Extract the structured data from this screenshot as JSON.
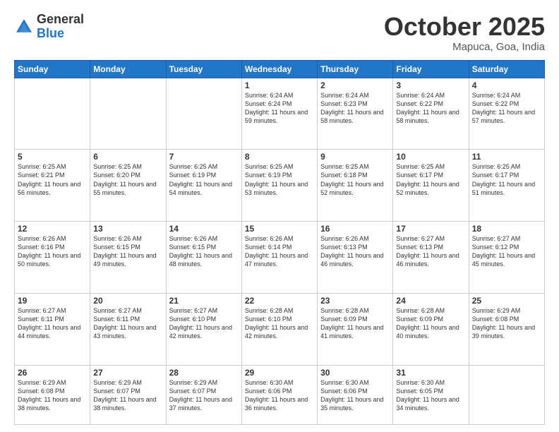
{
  "logo": {
    "general": "General",
    "blue": "Blue"
  },
  "header": {
    "month": "October 2025",
    "location": "Mapuca, Goa, India"
  },
  "weekdays": [
    "Sunday",
    "Monday",
    "Tuesday",
    "Wednesday",
    "Thursday",
    "Friday",
    "Saturday"
  ],
  "weeks": [
    [
      {
        "day": "",
        "info": ""
      },
      {
        "day": "",
        "info": ""
      },
      {
        "day": "",
        "info": ""
      },
      {
        "day": "1",
        "info": "Sunrise: 6:24 AM\nSunset: 6:24 PM\nDaylight: 11 hours\nand 59 minutes."
      },
      {
        "day": "2",
        "info": "Sunrise: 6:24 AM\nSunset: 6:23 PM\nDaylight: 11 hours\nand 58 minutes."
      },
      {
        "day": "3",
        "info": "Sunrise: 6:24 AM\nSunset: 6:22 PM\nDaylight: 11 hours\nand 58 minutes."
      },
      {
        "day": "4",
        "info": "Sunrise: 6:24 AM\nSunset: 6:22 PM\nDaylight: 11 hours\nand 57 minutes."
      }
    ],
    [
      {
        "day": "5",
        "info": "Sunrise: 6:25 AM\nSunset: 6:21 PM\nDaylight: 11 hours\nand 56 minutes."
      },
      {
        "day": "6",
        "info": "Sunrise: 6:25 AM\nSunset: 6:20 PM\nDaylight: 11 hours\nand 55 minutes."
      },
      {
        "day": "7",
        "info": "Sunrise: 6:25 AM\nSunset: 6:19 PM\nDaylight: 11 hours\nand 54 minutes."
      },
      {
        "day": "8",
        "info": "Sunrise: 6:25 AM\nSunset: 6:19 PM\nDaylight: 11 hours\nand 53 minutes."
      },
      {
        "day": "9",
        "info": "Sunrise: 6:25 AM\nSunset: 6:18 PM\nDaylight: 11 hours\nand 52 minutes."
      },
      {
        "day": "10",
        "info": "Sunrise: 6:25 AM\nSunset: 6:17 PM\nDaylight: 11 hours\nand 52 minutes."
      },
      {
        "day": "11",
        "info": "Sunrise: 6:25 AM\nSunset: 6:17 PM\nDaylight: 11 hours\nand 51 minutes."
      }
    ],
    [
      {
        "day": "12",
        "info": "Sunrise: 6:26 AM\nSunset: 6:16 PM\nDaylight: 11 hours\nand 50 minutes."
      },
      {
        "day": "13",
        "info": "Sunrise: 6:26 AM\nSunset: 6:15 PM\nDaylight: 11 hours\nand 49 minutes."
      },
      {
        "day": "14",
        "info": "Sunrise: 6:26 AM\nSunset: 6:15 PM\nDaylight: 11 hours\nand 48 minutes."
      },
      {
        "day": "15",
        "info": "Sunrise: 6:26 AM\nSunset: 6:14 PM\nDaylight: 11 hours\nand 47 minutes."
      },
      {
        "day": "16",
        "info": "Sunrise: 6:26 AM\nSunset: 6:13 PM\nDaylight: 11 hours\nand 46 minutes."
      },
      {
        "day": "17",
        "info": "Sunrise: 6:27 AM\nSunset: 6:13 PM\nDaylight: 11 hours\nand 46 minutes."
      },
      {
        "day": "18",
        "info": "Sunrise: 6:27 AM\nSunset: 6:12 PM\nDaylight: 11 hours\nand 45 minutes."
      }
    ],
    [
      {
        "day": "19",
        "info": "Sunrise: 6:27 AM\nSunset: 6:11 PM\nDaylight: 11 hours\nand 44 minutes."
      },
      {
        "day": "20",
        "info": "Sunrise: 6:27 AM\nSunset: 6:11 PM\nDaylight: 11 hours\nand 43 minutes."
      },
      {
        "day": "21",
        "info": "Sunrise: 6:27 AM\nSunset: 6:10 PM\nDaylight: 11 hours\nand 42 minutes."
      },
      {
        "day": "22",
        "info": "Sunrise: 6:28 AM\nSunset: 6:10 PM\nDaylight: 11 hours\nand 42 minutes."
      },
      {
        "day": "23",
        "info": "Sunrise: 6:28 AM\nSunset: 6:09 PM\nDaylight: 11 hours\nand 41 minutes."
      },
      {
        "day": "24",
        "info": "Sunrise: 6:28 AM\nSunset: 6:09 PM\nDaylight: 11 hours\nand 40 minutes."
      },
      {
        "day": "25",
        "info": "Sunrise: 6:29 AM\nSunset: 6:08 PM\nDaylight: 11 hours\nand 39 minutes."
      }
    ],
    [
      {
        "day": "26",
        "info": "Sunrise: 6:29 AM\nSunset: 6:08 PM\nDaylight: 11 hours\nand 38 minutes."
      },
      {
        "day": "27",
        "info": "Sunrise: 6:29 AM\nSunset: 6:07 PM\nDaylight: 11 hours\nand 38 minutes."
      },
      {
        "day": "28",
        "info": "Sunrise: 6:29 AM\nSunset: 6:07 PM\nDaylight: 11 hours\nand 37 minutes."
      },
      {
        "day": "29",
        "info": "Sunrise: 6:30 AM\nSunset: 6:06 PM\nDaylight: 11 hours\nand 36 minutes."
      },
      {
        "day": "30",
        "info": "Sunrise: 6:30 AM\nSunset: 6:06 PM\nDaylight: 11 hours\nand 35 minutes."
      },
      {
        "day": "31",
        "info": "Sunrise: 6:30 AM\nSunset: 6:05 PM\nDaylight: 11 hours\nand 34 minutes."
      },
      {
        "day": "",
        "info": ""
      }
    ]
  ]
}
